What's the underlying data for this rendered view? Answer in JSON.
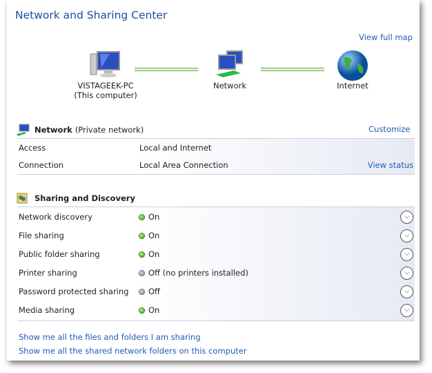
{
  "title": "Network and Sharing Center",
  "view_full_map": "View full map",
  "map": {
    "computer_name": "VISTAGEEK-PC",
    "computer_sub": "(This computer)",
    "network": "Network",
    "internet": "Internet"
  },
  "network": {
    "name": "Network",
    "type": "(Private network)",
    "customize": "Customize",
    "rows": [
      {
        "label": "Access",
        "value": "Local and Internet"
      },
      {
        "label": "Connection",
        "value": "Local Area Connection",
        "link": "View status"
      }
    ]
  },
  "sharing": {
    "title": "Sharing and Discovery",
    "rows": [
      {
        "label": "Network discovery",
        "status": "On",
        "state": "on"
      },
      {
        "label": "File sharing",
        "status": "On",
        "state": "on"
      },
      {
        "label": "Public folder sharing",
        "status": "On",
        "state": "on"
      },
      {
        "label": "Printer sharing",
        "status": "Off (no printers installed)",
        "state": "off"
      },
      {
        "label": "Password protected sharing",
        "status": "Off",
        "state": "off"
      },
      {
        "label": "Media sharing",
        "status": "On",
        "state": "on"
      }
    ]
  },
  "links": [
    "Show me all the files and folders I am sharing",
    "Show me all the shared network folders on this computer"
  ]
}
